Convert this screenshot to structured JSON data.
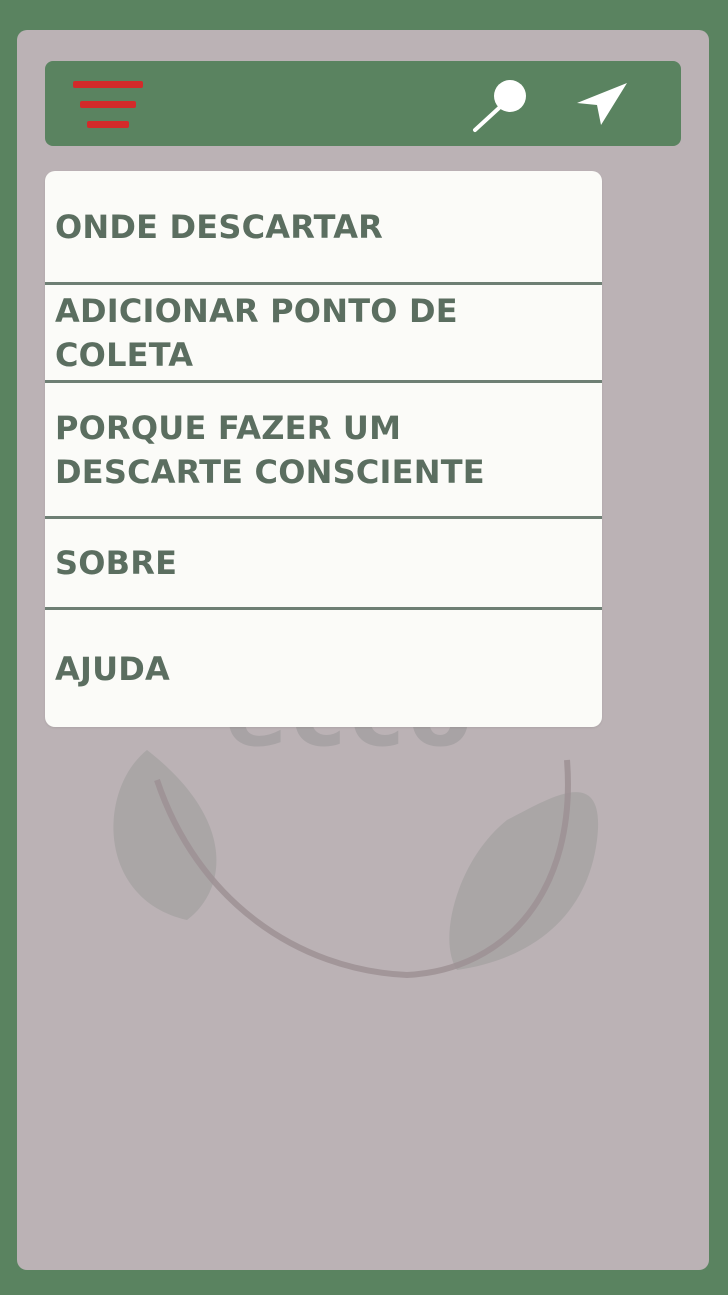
{
  "colors": {
    "frame_green": "#5a8360",
    "screen_background": "#bbb2b5",
    "menu_background": "#fbfbf8",
    "menu_text": "#5b6e60",
    "hamburger_red": "#d32a2a",
    "icon_white": "#ffffff",
    "watermark_gray": "#a8a3a5"
  },
  "toolbar": {
    "menu_icon": "hamburger-menu-icon",
    "search_icon": "search-icon",
    "navigation_icon": "navigation-arrow-icon"
  },
  "menu": {
    "items": [
      {
        "label": "ONDE DESCARTAR"
      },
      {
        "label": "ADICIONAR PONTO DE COLETA"
      },
      {
        "label": "PORQUE FAZER UM DESCARTE CONSCIENTE"
      },
      {
        "label": "SOBRE"
      },
      {
        "label": "AJUDA"
      }
    ]
  },
  "watermark": {
    "text": "ecco",
    "icon": "leaf-logo-icon"
  }
}
